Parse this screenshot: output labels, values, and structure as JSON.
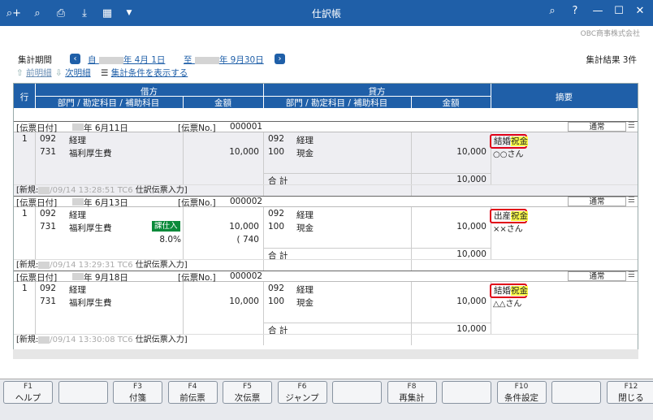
{
  "window": {
    "title": "仕訳帳",
    "company": "OBC商事株式会社"
  },
  "toolbar": {
    "icons": [
      "search-plus-icon",
      "search-doc-icon",
      "print-icon",
      "pdf-export-icon",
      "excel-export-icon",
      "dropdown-icon"
    ]
  },
  "period": {
    "label": "集計期間",
    "from_prefix": "自",
    "from_rest": "年  4月 1日",
    "to_prefix": "至",
    "to_rest": "年  9月30日",
    "result": "集計結果 3件"
  },
  "nav": {
    "prev": "前明細",
    "next": "次明細",
    "show_cond": "集計条件を表示する"
  },
  "table": {
    "col_line": "行",
    "debit": "借方",
    "credit": "貸方",
    "memo": "摘要",
    "dept_label": "部門 / 勘定科目 / 補助科目",
    "amount_label": "金額"
  },
  "slips": [
    {
      "date_label": "[伝票日付]",
      "date_rest": "年  6月11日",
      "no_label": "[伝票No.]",
      "no": "000001",
      "status": "通常",
      "line": "1",
      "d_code1": "092",
      "d_name1": "経理",
      "d_code2": "731",
      "d_name2": "福利厚生費",
      "d_amount": "10,000",
      "c_code1": "092",
      "c_name1": "経理",
      "c_code2": "100",
      "c_name2": "現金",
      "c_amount": "10,000",
      "memo_pre": "結婚",
      "memo_hl": "祝金",
      "memo2": "○○さん",
      "total_label": "合  計",
      "total": "10,000",
      "footer_prefix": "[新規:",
      "footer_time": "/09/14  13:28:51  TC6",
      "footer_suffix": "仕訳伝票入力]"
    },
    {
      "date_label": "[伝票日付]",
      "date_rest": "年  6月13日",
      "no_label": "[伝票No.]",
      "no": "000002",
      "status": "通常",
      "line": "1",
      "d_code1": "092",
      "d_name1": "経理",
      "d_code2": "731",
      "d_name2": "福利厚生費",
      "d_amount": "10,000",
      "tax_tag": "課仕入",
      "tax_rate": "8.0%",
      "tax_amount": "( 740",
      "c_code1": "092",
      "c_name1": "経理",
      "c_code2": "100",
      "c_name2": "現金",
      "c_amount": "10,000",
      "memo_pre": "出産",
      "memo_hl": "祝金",
      "memo2": "××さん",
      "total_label": "合  計",
      "total": "10,000",
      "footer_prefix": "[新規:",
      "footer_time": "/09/14  13:29:31  TC6",
      "footer_suffix": "仕訳伝票入力]"
    },
    {
      "date_label": "[伝票日付]",
      "date_rest": "年  9月18日",
      "no_label": "[伝票No.]",
      "no": "000002",
      "status": "通常",
      "line": "1",
      "d_code1": "092",
      "d_name1": "経理",
      "d_code2": "731",
      "d_name2": "福利厚生費",
      "d_amount": "10,000",
      "c_code1": "092",
      "c_name1": "経理",
      "c_code2": "100",
      "c_name2": "現金",
      "c_amount": "10,000",
      "memo_pre": "結婚",
      "memo_hl": "祝金",
      "memo2": "△△さん",
      "total_label": "合  計",
      "total": "10,000",
      "footer_prefix": "[新規:",
      "footer_time": "/09/14  13:30:08  TC6",
      "footer_suffix": "仕訳伝票入力]"
    }
  ],
  "fkeys": [
    {
      "n": "F1",
      "l": "ヘルプ"
    },
    {
      "n": "",
      "l": ""
    },
    {
      "n": "F3",
      "l": "付箋"
    },
    {
      "n": "F4",
      "l": "前伝票"
    },
    {
      "n": "F5",
      "l": "次伝票"
    },
    {
      "n": "F6",
      "l": "ジャンプ"
    },
    {
      "n": "",
      "l": ""
    },
    {
      "n": "F8",
      "l": "再集計"
    },
    {
      "n": "",
      "l": ""
    },
    {
      "n": "F10",
      "l": "条件設定"
    },
    {
      "n": "",
      "l": ""
    },
    {
      "n": "F12",
      "l": "閉じる"
    }
  ]
}
